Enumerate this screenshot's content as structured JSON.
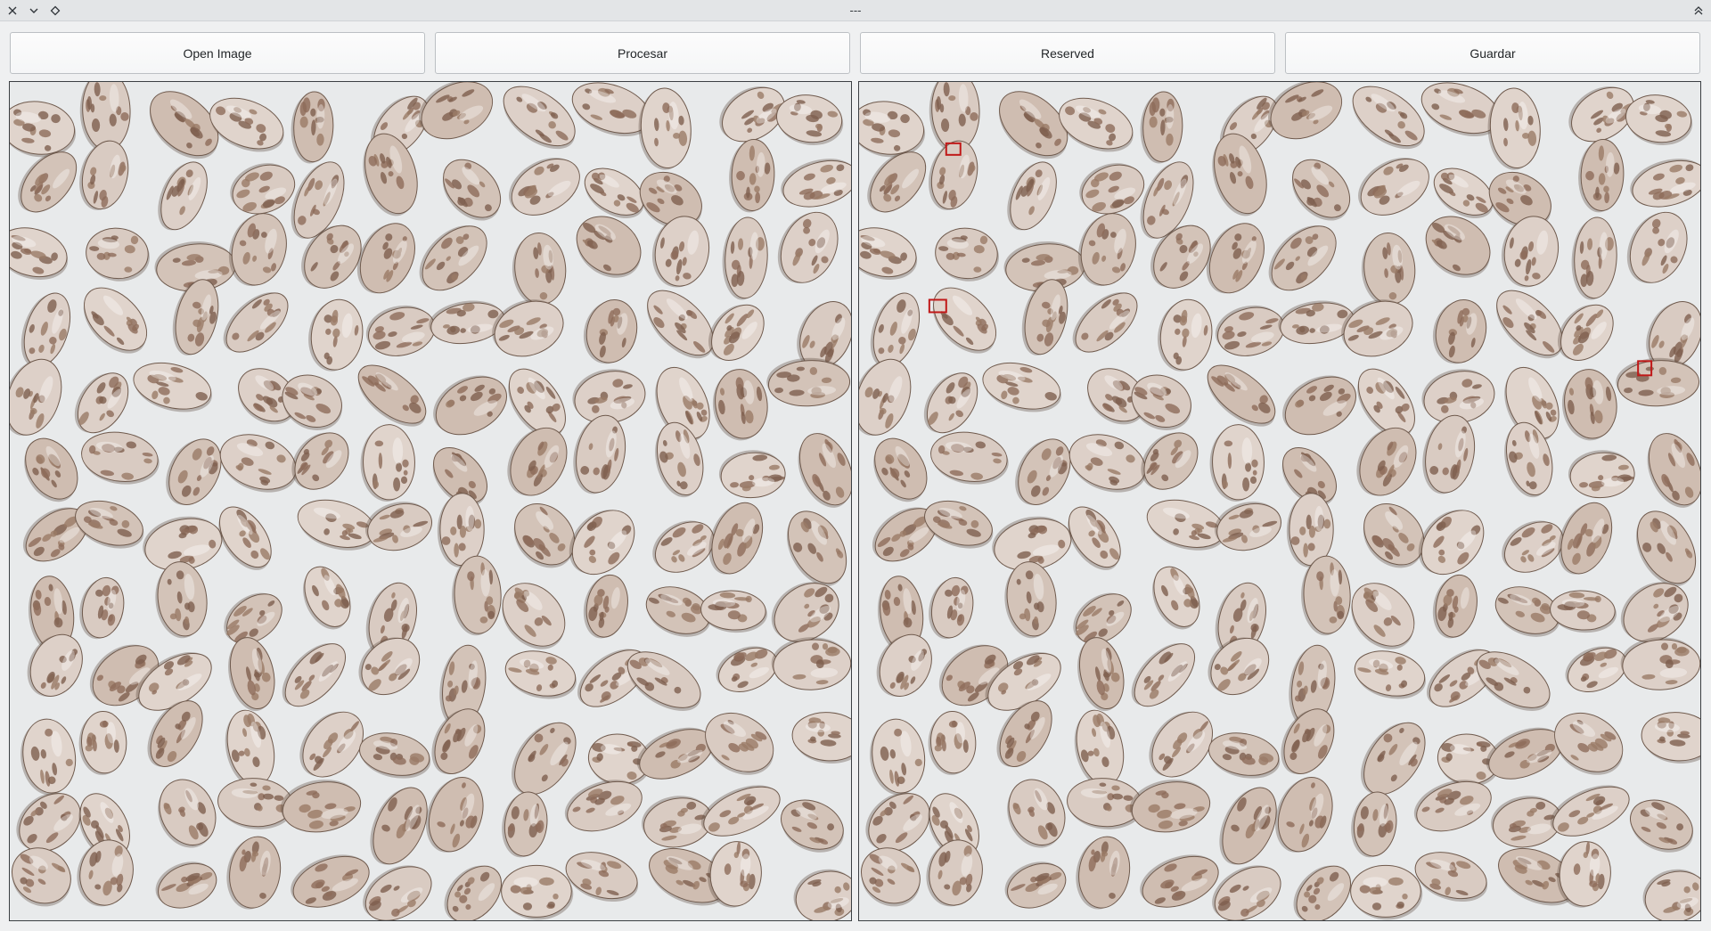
{
  "window": {
    "title": "---",
    "icons": [
      "close-icon",
      "minimize-icon",
      "keep-above-icon",
      "collapse-icon"
    ]
  },
  "toolbar": {
    "open_label": "Open Image",
    "process_label": "Procesar",
    "reserved_label": "Reserved",
    "save_label": "Guardar"
  },
  "panels": {
    "original": {
      "content": "beans-photo-original"
    },
    "processed": {
      "content": "beans-photo-processed",
      "detections": 3,
      "marker_color": "#c01818"
    }
  },
  "colors": {
    "background": "#eff0f1",
    "bean_light": "#d6c7bd",
    "bean_speckle": "#8a6a58",
    "surface": "#e9ebec"
  }
}
